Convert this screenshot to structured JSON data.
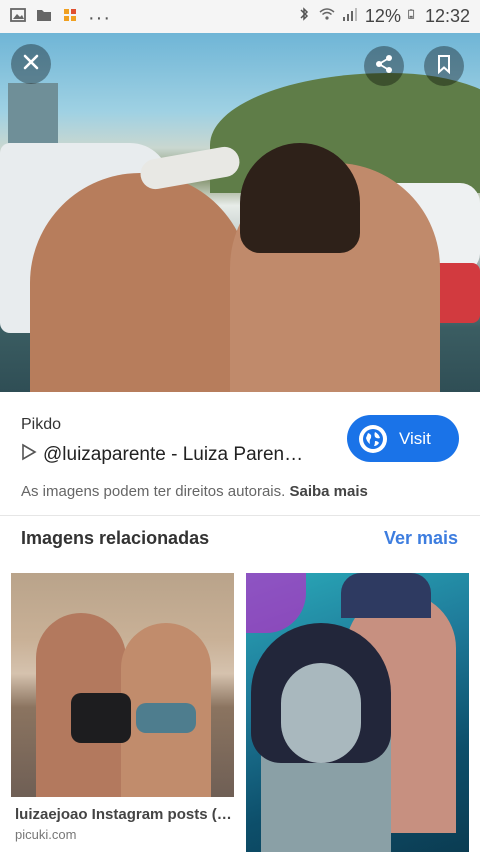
{
  "status_bar": {
    "battery_percent": "12%",
    "time": "12:32",
    "left_icons": [
      "image-icon",
      "folder-icon",
      "app-icon",
      "more-dots-icon"
    ],
    "right_icons": [
      "bluetooth-icon",
      "wifi-icon",
      "signal-icon",
      "battery-icon"
    ]
  },
  "image_viewer": {
    "close_icon": "close-icon",
    "share_icon": "share-icon",
    "bookmark_icon": "bookmark-icon"
  },
  "result": {
    "source_name": "Pikdo",
    "title": "@luizaparente - Luiza Paren…",
    "visit_label": "Visit",
    "copyright_text": "As imagens podem ter direitos autorais.",
    "learn_more": "Saiba mais"
  },
  "related": {
    "heading": "Imagens relacionadas",
    "see_more": "Ver mais",
    "items": [
      {
        "caption": "luizaejoao Instagram posts (p…",
        "site": "picuki.com"
      }
    ]
  },
  "colors": {
    "accent": "#1a73e8",
    "link": "#3d7ddf"
  }
}
